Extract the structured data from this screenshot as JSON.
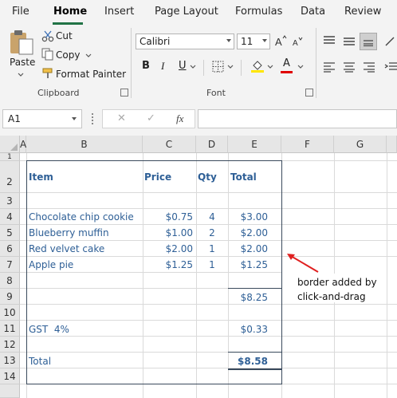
{
  "tabs": [
    "File",
    "Home",
    "Insert",
    "Page Layout",
    "Formulas",
    "Data",
    "Review"
  ],
  "clipboard": {
    "paste": "Paste",
    "cut": "Cut",
    "copy": "Copy",
    "format_painter": "Format Painter",
    "label": "Clipboard"
  },
  "font": {
    "name": "Calibri",
    "size": "11",
    "label": "Font",
    "bold": "B",
    "italic": "I",
    "underline": "U",
    "color_letter": "A"
  },
  "formula_bar": {
    "name_box": "A1",
    "fx": "fx",
    "cancel": "✕",
    "enter": "✓"
  },
  "grid": {
    "columns": [
      "A",
      "B",
      "C",
      "D",
      "E",
      "F",
      "G"
    ],
    "rows": [
      "1",
      "2",
      "3",
      "4",
      "5",
      "6",
      "7",
      "8",
      "9",
      "10",
      "11",
      "12",
      "13",
      "14"
    ]
  },
  "table": {
    "headers": {
      "item": "Item",
      "price": "Price",
      "qty": "Qty",
      "total": "Total"
    },
    "items": [
      {
        "item": "Chocolate chip cookie",
        "price": "$0.75",
        "qty": "4",
        "total": "$3.00"
      },
      {
        "item": "Blueberry muffin",
        "price": "$1.00",
        "qty": "2",
        "total": "$2.00"
      },
      {
        "item": "Red velvet cake",
        "price": "$2.00",
        "qty": "1",
        "total": "$2.00"
      },
      {
        "item": "Apple pie",
        "price": "$1.25",
        "qty": "1",
        "total": "$1.25"
      }
    ],
    "subtotal": "$8.25",
    "gst_label": "GST  4%",
    "gst_value": "$0.33",
    "total_label": "Total",
    "total_value": "$8.58"
  },
  "annotation": {
    "line1": "border added by",
    "line2": "click-and-drag"
  },
  "colors": {
    "accent": "#217346",
    "cell_text": "#2e5f96",
    "arrow": "#e02020"
  }
}
